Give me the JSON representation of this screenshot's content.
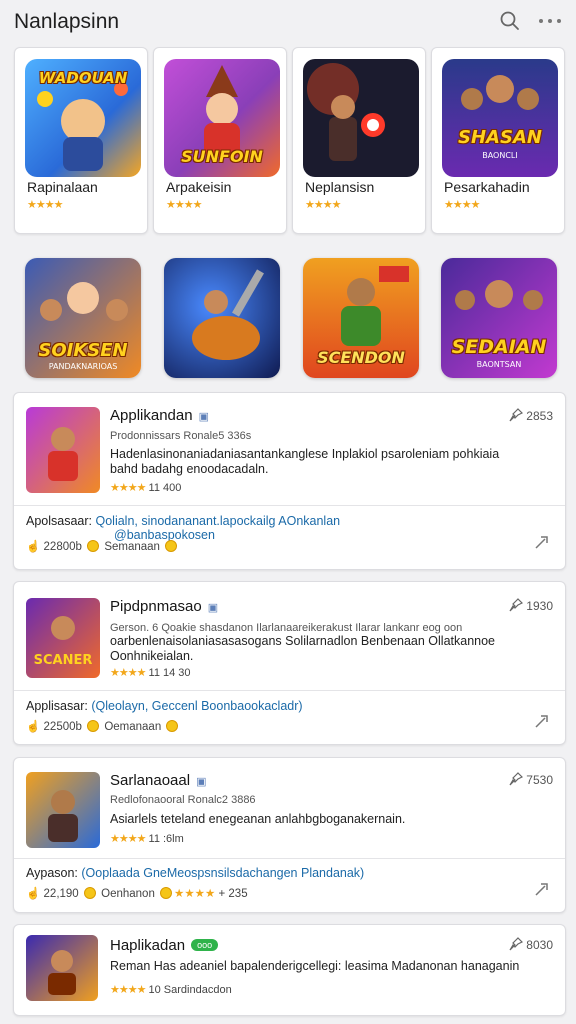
{
  "header": {
    "title": "Nanlapsinn",
    "search_icon": "search-icon",
    "more_icon": "more-horizontal-icon"
  },
  "featured_tiles": [
    {
      "name": "Rapinalaan",
      "rating": 4,
      "art_title": "WADOUAN",
      "art_sub": "",
      "colors": [
        "#2a6ad8",
        "#f5a623"
      ]
    },
    {
      "name": "Arpakeisin",
      "rating": 4,
      "art_title": "SUNFOIN",
      "art_sub": "",
      "colors": [
        "#8a3fb8",
        "#f06a2a"
      ]
    },
    {
      "name": "Neplansisn",
      "rating": 4,
      "art_title": "",
      "art_sub": "",
      "colors": [
        "#1b1b2e",
        "#e0461f"
      ]
    },
    {
      "name": "Pesarkahadin",
      "rating": 4,
      "art_title": "SHASAN",
      "art_sub": "BAONCLI",
      "colors": [
        "#3a4ba8",
        "#f0b429"
      ]
    }
  ],
  "second_row_art": [
    {
      "art_title": "SOIKSEN",
      "art_sub": "PANDAKNARIOAS",
      "colors": [
        "#3b5bb5",
        "#f08a24"
      ]
    },
    {
      "art_title": "",
      "art_sub": "",
      "colors": [
        "#1f3f9a",
        "#d87a1f"
      ]
    },
    {
      "art_title": "SCENDON",
      "art_sub": "",
      "colors": [
        "#f07a1a",
        "#3d8a2a"
      ]
    },
    {
      "art_title": "SEDAIAN",
      "art_sub": "BAONTSAN",
      "colors": [
        "#7a2fb0",
        "#e8b21f"
      ]
    }
  ],
  "list_items": [
    {
      "name": "Applikandan",
      "badge": "▣",
      "meta": "Prodonnissars  Ronale5 336s",
      "desc": "Hadenlasinonaniadaniasantankanglese Inplakiol  psaroleniam pohkiaia bahd badahg enoodacadaln.",
      "rating_text": "11 400",
      "pin_count": "2853",
      "link_label": "Apolsasaar:",
      "link_text": "Qolialn, sinodananant.lapockailg AOnkanlan",
      "link_text2": "@banbaspokosen",
      "foot_count": "22800b",
      "foot_label": "Semanaan"
    },
    {
      "name": "Pipdpnmasao",
      "badge": "▣",
      "meta": "Gerson. 6 Qoakie shasdanon  Ilarlanaareikerakust Ilarar lankanr eog oon",
      "desc": "oarbenlenaisolaniasasasogans Solilarnadlon Benbenaan Ollatkannoe Oonhnikeialan.",
      "rating_text": "11 14 30",
      "pin_count": "1930",
      "link_label": "Applisasar:",
      "link_text": "(Qleolayn, Geccenl Boonbaookacladr)",
      "link_text2": "",
      "foot_count": "22500b",
      "foot_label": "Oemanaan"
    },
    {
      "name": "Sarlanaoaal",
      "badge": "▣",
      "meta": "Redlofonaooral  Ronalc2 3886",
      "desc": "Asiarlels teteland enegeanan anlahbgboganakernain.",
      "rating_text": "11 :6lm",
      "pin_count": "7530",
      "link_label": "Aypason:",
      "link_text": "(Ooplaada GneMeospsnsilsdachangen Plandanak)",
      "link_text2": "",
      "foot_count": "22,190",
      "foot_label": "Oenhanon",
      "foot_extra": "+ 235"
    },
    {
      "name": "Haplikadan",
      "badge": "ooo",
      "meta": "",
      "desc": "Reman Has adeaniel bapalenderigcellegi: leasima Madanonan hanaganin",
      "rating_text": "10  Sardindacdon",
      "pin_count": "8030",
      "link_label": "",
      "link_text": "",
      "link_text2": "",
      "foot_count": "",
      "foot_label": ""
    }
  ]
}
